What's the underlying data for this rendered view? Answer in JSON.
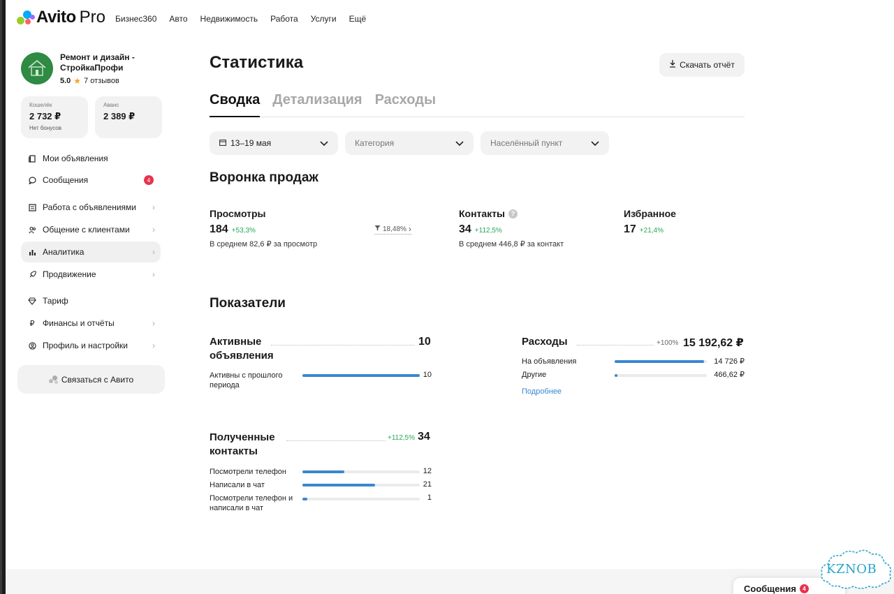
{
  "app": {
    "logo_text": "Avito",
    "logo_pro": "Pro",
    "logo_colors": [
      "#00aaff",
      "#97cf26",
      "#ff6163",
      "#a169f7"
    ]
  },
  "topnav": {
    "items": [
      "Бизнес360",
      "Авто",
      "Недвижимость",
      "Работа",
      "Услуги",
      "Ещё"
    ]
  },
  "company": {
    "name": "Ремонт и дизайн - СтройкаПрофи",
    "rating": "5.0",
    "reviews": "7 отзывов"
  },
  "wallet": {
    "label": "Кошелёк",
    "value": "2 732 ₽",
    "sub": "Нет бонусов"
  },
  "advance": {
    "label": "Аванс",
    "value": "2 389 ₽"
  },
  "sidebar": {
    "items": [
      {
        "label": "Мои объявления",
        "icon": "document-icon"
      },
      {
        "label": "Сообщения",
        "icon": "chat-icon",
        "badge": "4"
      },
      {
        "label": "Работа с объявлениями",
        "icon": "list-icon"
      },
      {
        "label": "Общение с клиентами",
        "icon": "people-icon"
      },
      {
        "label": "Аналитика",
        "icon": "chart-icon"
      },
      {
        "label": "Продвижение",
        "icon": "rocket-icon"
      },
      {
        "label": "Тариф",
        "icon": "diamond-icon"
      },
      {
        "label": "Финансы и отчёты",
        "icon": "ruble-icon"
      },
      {
        "label": "Профиль и настройки",
        "icon": "profile-icon"
      }
    ],
    "contact_button": "Связаться с Авито"
  },
  "page": {
    "title": "Статистика",
    "download_button": "Скачать отчёт",
    "tabs": [
      "Сводка",
      "Детализация",
      "Расходы"
    ],
    "active_tab": "Сводка"
  },
  "filters": {
    "date": "13–19 мая",
    "category_placeholder": "Категория",
    "city_placeholder": "Населённый пункт"
  },
  "funnel": {
    "title": "Воронка продаж",
    "views": {
      "label": "Просмотры",
      "value": "184",
      "delta": "+53,3%",
      "sub": "В среднем 82,6 ₽ за просмотр"
    },
    "conversion": "18,48%",
    "contacts": {
      "label": "Контакты",
      "value": "34",
      "delta": "+112,5%",
      "sub": "В среднем 446,8 ₽ за контакт"
    },
    "favorites": {
      "label": "Избранное",
      "value": "17",
      "delta": "+21,4%"
    }
  },
  "indicators": {
    "title": "Показатели",
    "active_ads": {
      "title": "Активные объявления",
      "value": "10",
      "rows": [
        {
          "label": "Активны с прошлого периода",
          "value": "10",
          "fraction": 1.0
        }
      ]
    },
    "expenses": {
      "title": "Расходы",
      "delta": "+100%",
      "value": "15 192,62 ₽",
      "rows": [
        {
          "label": "На объявления",
          "value": "14 726 ₽",
          "fraction": 0.97
        },
        {
          "label": "Другие",
          "value": "466,62 ₽",
          "fraction": 0.03
        }
      ],
      "more_link": "Подробнее"
    },
    "contacts": {
      "title": "Полученные контакты",
      "delta": "+112,5%",
      "value": "34",
      "rows": [
        {
          "label": "Посмотрели телефон",
          "value": "12",
          "fraction": 0.36
        },
        {
          "label": "Написали в чат",
          "value": "21",
          "fraction": 0.62
        },
        {
          "label": "Посмотрели телефон и написали в чат",
          "value": "1",
          "fraction": 0.04
        }
      ]
    }
  },
  "messages_widget": {
    "label": "Сообщения",
    "badge": "4"
  },
  "watermark": "KZNOB"
}
